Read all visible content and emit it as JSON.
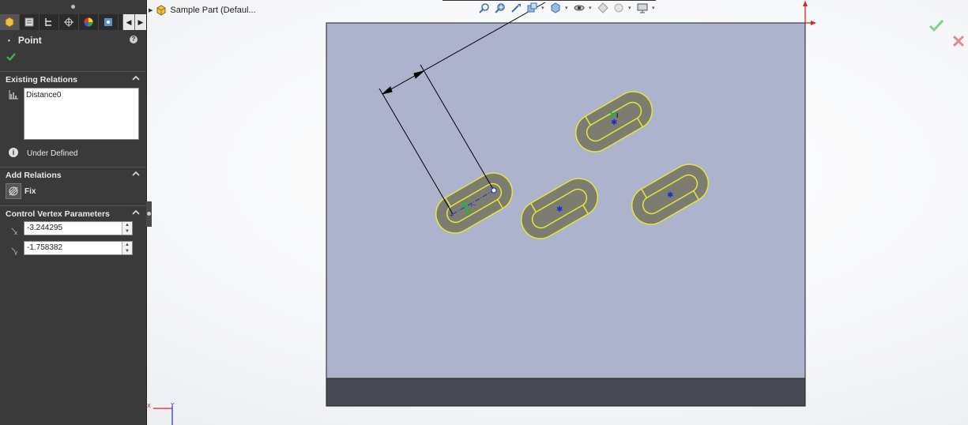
{
  "property_manager": {
    "title": "Point",
    "help_icon": "question-icon",
    "existing_relations": {
      "header": "Existing Relations",
      "items": [
        "Distance0"
      ],
      "status": "Under Defined"
    },
    "add_relations": {
      "header": "Add Relations",
      "fix_label": "Fix"
    },
    "control_vertex": {
      "header": "Control Vertex Parameters",
      "x_value": "-3.244295",
      "y_value": "-1.758382"
    }
  },
  "feature_tree": {
    "part_name": "Sample Part  (Defaul..."
  },
  "colors": {
    "panel_bg": "#3a3a3a",
    "sketch_plane": "#aeb3cd",
    "slot_fill": "#7c7c70",
    "slot_outline": "#e6e63a",
    "ok_green": "#4caf50",
    "cancel_red": "#d9534f"
  }
}
